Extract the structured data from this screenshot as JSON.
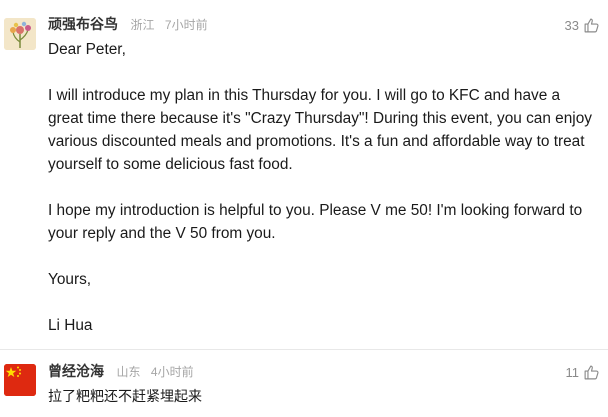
{
  "comments": [
    {
      "username": "顽强布谷鸟",
      "location": "浙江",
      "time": "7小时前",
      "likes": "33",
      "paragraphs": [
        "Dear Peter,",
        "I will introduce my plan in this Thursday for you. I will go to KFC and have a great time there because it's \"Crazy Thursday\"! During this event, you can enjoy various discounted meals and promotions. It's a fun and affordable way to treat yourself to some delicious fast food.",
        "I hope my introduction is helpful to you. Please V me 50! I'm looking forward to your reply and the V 50 from you.",
        "Yours,",
        "Li Hua"
      ]
    },
    {
      "username": "曾经沧海",
      "location": "山东",
      "time": "4小时前",
      "likes": "11",
      "paragraphs": [
        "拉了粑粑还不赶紧埋起来"
      ]
    }
  ],
  "icons": {
    "like": "thumbs-up-icon",
    "avatar1": "flower-avatar-icon",
    "avatar2": "china-flag-avatar-icon"
  },
  "colors": {
    "username": "#333333",
    "meta": "#a6a6a6",
    "flag_red": "#de2910",
    "flag_star": "#ffde00"
  }
}
